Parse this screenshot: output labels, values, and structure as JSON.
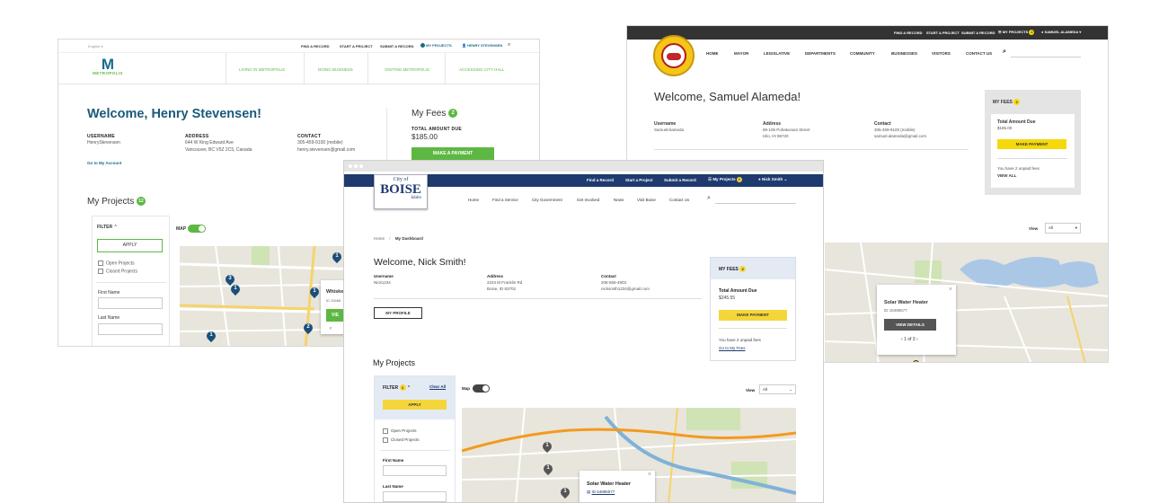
{
  "metro": {
    "language": "English",
    "utility": [
      "FIND A RECORD",
      "START A PROJECT",
      "SUBMIT A RECORD",
      "MY PROJECTS",
      "HENRY STEVENSEN"
    ],
    "logo_letter": "M",
    "logo_name": "METROPOLIS",
    "nav": [
      "LIVING IN METROPOLIS",
      "DOING BUSINESS",
      "VISITING METROPOLIS",
      "ACCESSING CITY HALL"
    ],
    "welcome": "Welcome, Henry Stevensen!",
    "username_label": "USERNAME",
    "username": "HenryStevensen",
    "address_label": "ADDRESS",
    "address1": "644 W King Edward Ave",
    "address2": "Vancouver, BC V5Z 2C5, Canada",
    "contact_label": "CONTACT",
    "phone": "305-459-9100 (mobile)",
    "email": "henry.stevensen@gmail.com",
    "account_link": "Go to My Account",
    "fees_title": "My Fees",
    "fees_count": "2",
    "total_label": "TOTAL AMOUNT DUE",
    "total": "$185.00",
    "make_payment": "MAKE A PAYMENT",
    "projects_title": "My Projects",
    "projects_count": "12",
    "filter": "FILTER",
    "apply": "APPLY",
    "open_projects": "Open Projects",
    "closed_projects": "Closed Projects",
    "first_name": "First Name",
    "last_name": "Last Name",
    "map_label": "MAP",
    "popup_title": "Whiskey",
    "popup_id": "ID 15468",
    "popup_btn": "VIE",
    "pins": [
      "1",
      "3",
      "1",
      "1",
      "2",
      "1"
    ],
    "brand_color": "#1a6b8a",
    "accent_color": "#5db843"
  },
  "samuel": {
    "utility": [
      "FIND A RECORD",
      "START A PROJECT",
      "SUBMIT A RECORD",
      "MY PROJECTS",
      "SAMUEL ALAMEDA"
    ],
    "projects_badge": "2",
    "nav": [
      "HOME",
      "MAYOR",
      "LEGISLATIVE",
      "DEPARTMENTS",
      "COMMUNITY",
      "BUSINESSES",
      "VISITORS",
      "CONTACT US"
    ],
    "welcome": "Welcome, Samuel Alameda!",
    "username_label": "Username",
    "username": "SamuelAlameda",
    "address_label": "Address",
    "address1": "89-105 Pohakunani Street",
    "address2": "Hilo, HI 96720",
    "contact_label": "Contact",
    "phone": "305-459-9100 (mobile)",
    "email": "samuel.alameda@gmail.com",
    "fees_title": "MY FEES",
    "fees_count": "2",
    "total_label": "Total Amount Due",
    "total": "$185.00",
    "make_payment": "MAKE PAYMENT",
    "unpaid": "You have 2 unpaid fees",
    "view_all": "VIEW ALL",
    "view_label": "View",
    "view_value": "All",
    "popup_title": "Solar Water Heater",
    "popup_id": "ID 15486577",
    "popup_btn": "VIEW DETAILS",
    "popup_pager": "1 of 3",
    "header_color": "#333333",
    "accent_color": "#f5d90a"
  },
  "boise": {
    "logo_city_of": "City of",
    "logo_boise": "BOISE",
    "logo_idaho": "Idaho",
    "utility": [
      "Find a Record",
      "Start a Project",
      "Submit a Record",
      "My Projects",
      "Nick Smith"
    ],
    "projects_badge": "2",
    "nav": [
      "Home",
      "Find a Service",
      "City Government",
      "Get Involved",
      "News",
      "Visit Boise",
      "Contact Us"
    ],
    "breadcrumb_home": "Home",
    "breadcrumb_sep": "/",
    "breadcrumb_current": "My Dashboard",
    "welcome": "Welcome, Nick Smith!",
    "username_label": "Username",
    "username": "Nick1234",
    "address_label": "Address",
    "address1": "2234 M Franklin Rd",
    "address2": "Boise, ID 83702",
    "contact_label": "Contact",
    "phone": "208-555-4903",
    "email": "nicksmith1234@gmail.com",
    "my_profile": "MY PROFILE",
    "fees_title": "MY FEES",
    "fees_count": "2",
    "total_label": "Total Amount Due",
    "total": "$245.55",
    "make_payment": "MAKE PAYMENT",
    "unpaid": "You have 2 unpaid fees",
    "go_to_fees": "Go to My Fees",
    "projects_title": "My Projects",
    "filter": "FILTER",
    "filter_count": "1",
    "clear_all": "Clear All",
    "apply": "APPLY",
    "open_projects": "Open Projects",
    "closed_projects": "Closed Projects",
    "first_name": "First Name",
    "last_name": "Last Name",
    "map_label": "Map",
    "view_label": "View",
    "view_value": "All",
    "popup_title": "Solar Water Heater",
    "popup_id": "ID 54896577",
    "pins": [
      "1",
      "1",
      "1"
    ],
    "header_color": "#1e3a6e",
    "accent_color": "#f5d63a"
  }
}
